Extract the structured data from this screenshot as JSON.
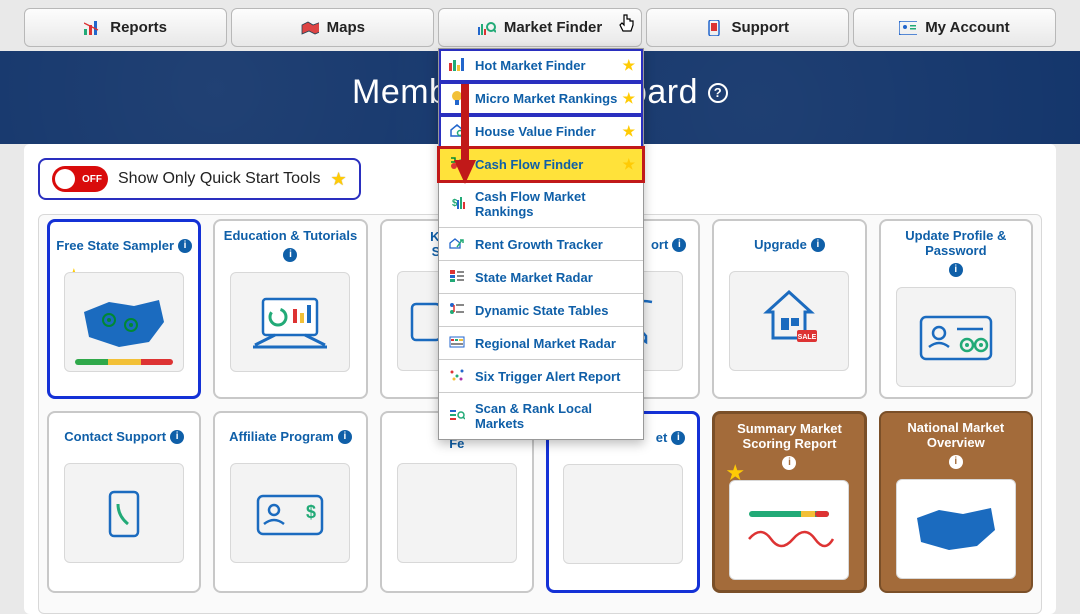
{
  "nav": {
    "items": [
      {
        "label": "Reports"
      },
      {
        "label": "Maps"
      },
      {
        "label": "Market Finder"
      },
      {
        "label": "Support"
      },
      {
        "label": "My Account"
      }
    ]
  },
  "hero": {
    "title_left": "Memb",
    "title_right": "oard",
    "help": "?"
  },
  "toggle": {
    "switch_text": "OFF",
    "label": "Show Only Quick Start Tools"
  },
  "dropdown": {
    "items": [
      {
        "label": "Hot Market Finder",
        "starred": true,
        "boxed": true
      },
      {
        "label": "Micro Market Rankings",
        "starred": true,
        "boxed": true
      },
      {
        "label": "House Value Finder",
        "starred": true,
        "boxed": true
      },
      {
        "label": "Cash Flow Finder",
        "starred": true,
        "selected": true
      },
      {
        "label": "Cash Flow Market Rankings"
      },
      {
        "label": "Rent Growth Tracker"
      },
      {
        "label": "State Market Radar"
      },
      {
        "label": "Dynamic State Tables"
      },
      {
        "label": "Regional Market Radar"
      },
      {
        "label": "Six Trigger Alert Report"
      },
      {
        "label": "Scan & Rank Local Markets"
      }
    ]
  },
  "cards": {
    "row1": [
      {
        "title": "Free State Sampler",
        "highlight": true,
        "star": true
      },
      {
        "title": "Education & Tutorials"
      },
      {
        "title": "Know\nSupp"
      },
      {
        "title": "ort"
      },
      {
        "title": "Upgrade"
      },
      {
        "title": "Update Profile & Password"
      }
    ],
    "row2": [
      {
        "title": "Contact Support"
      },
      {
        "title": "Affiliate Program"
      },
      {
        "title": "Sugg\nFe"
      },
      {
        "title": "et",
        "highlight": true
      },
      {
        "title": "Summary Market Scoring Report",
        "highlight": true,
        "brown": true,
        "star": true
      },
      {
        "title": "National Market Overview",
        "brown": true
      }
    ]
  },
  "info_glyph": "i"
}
